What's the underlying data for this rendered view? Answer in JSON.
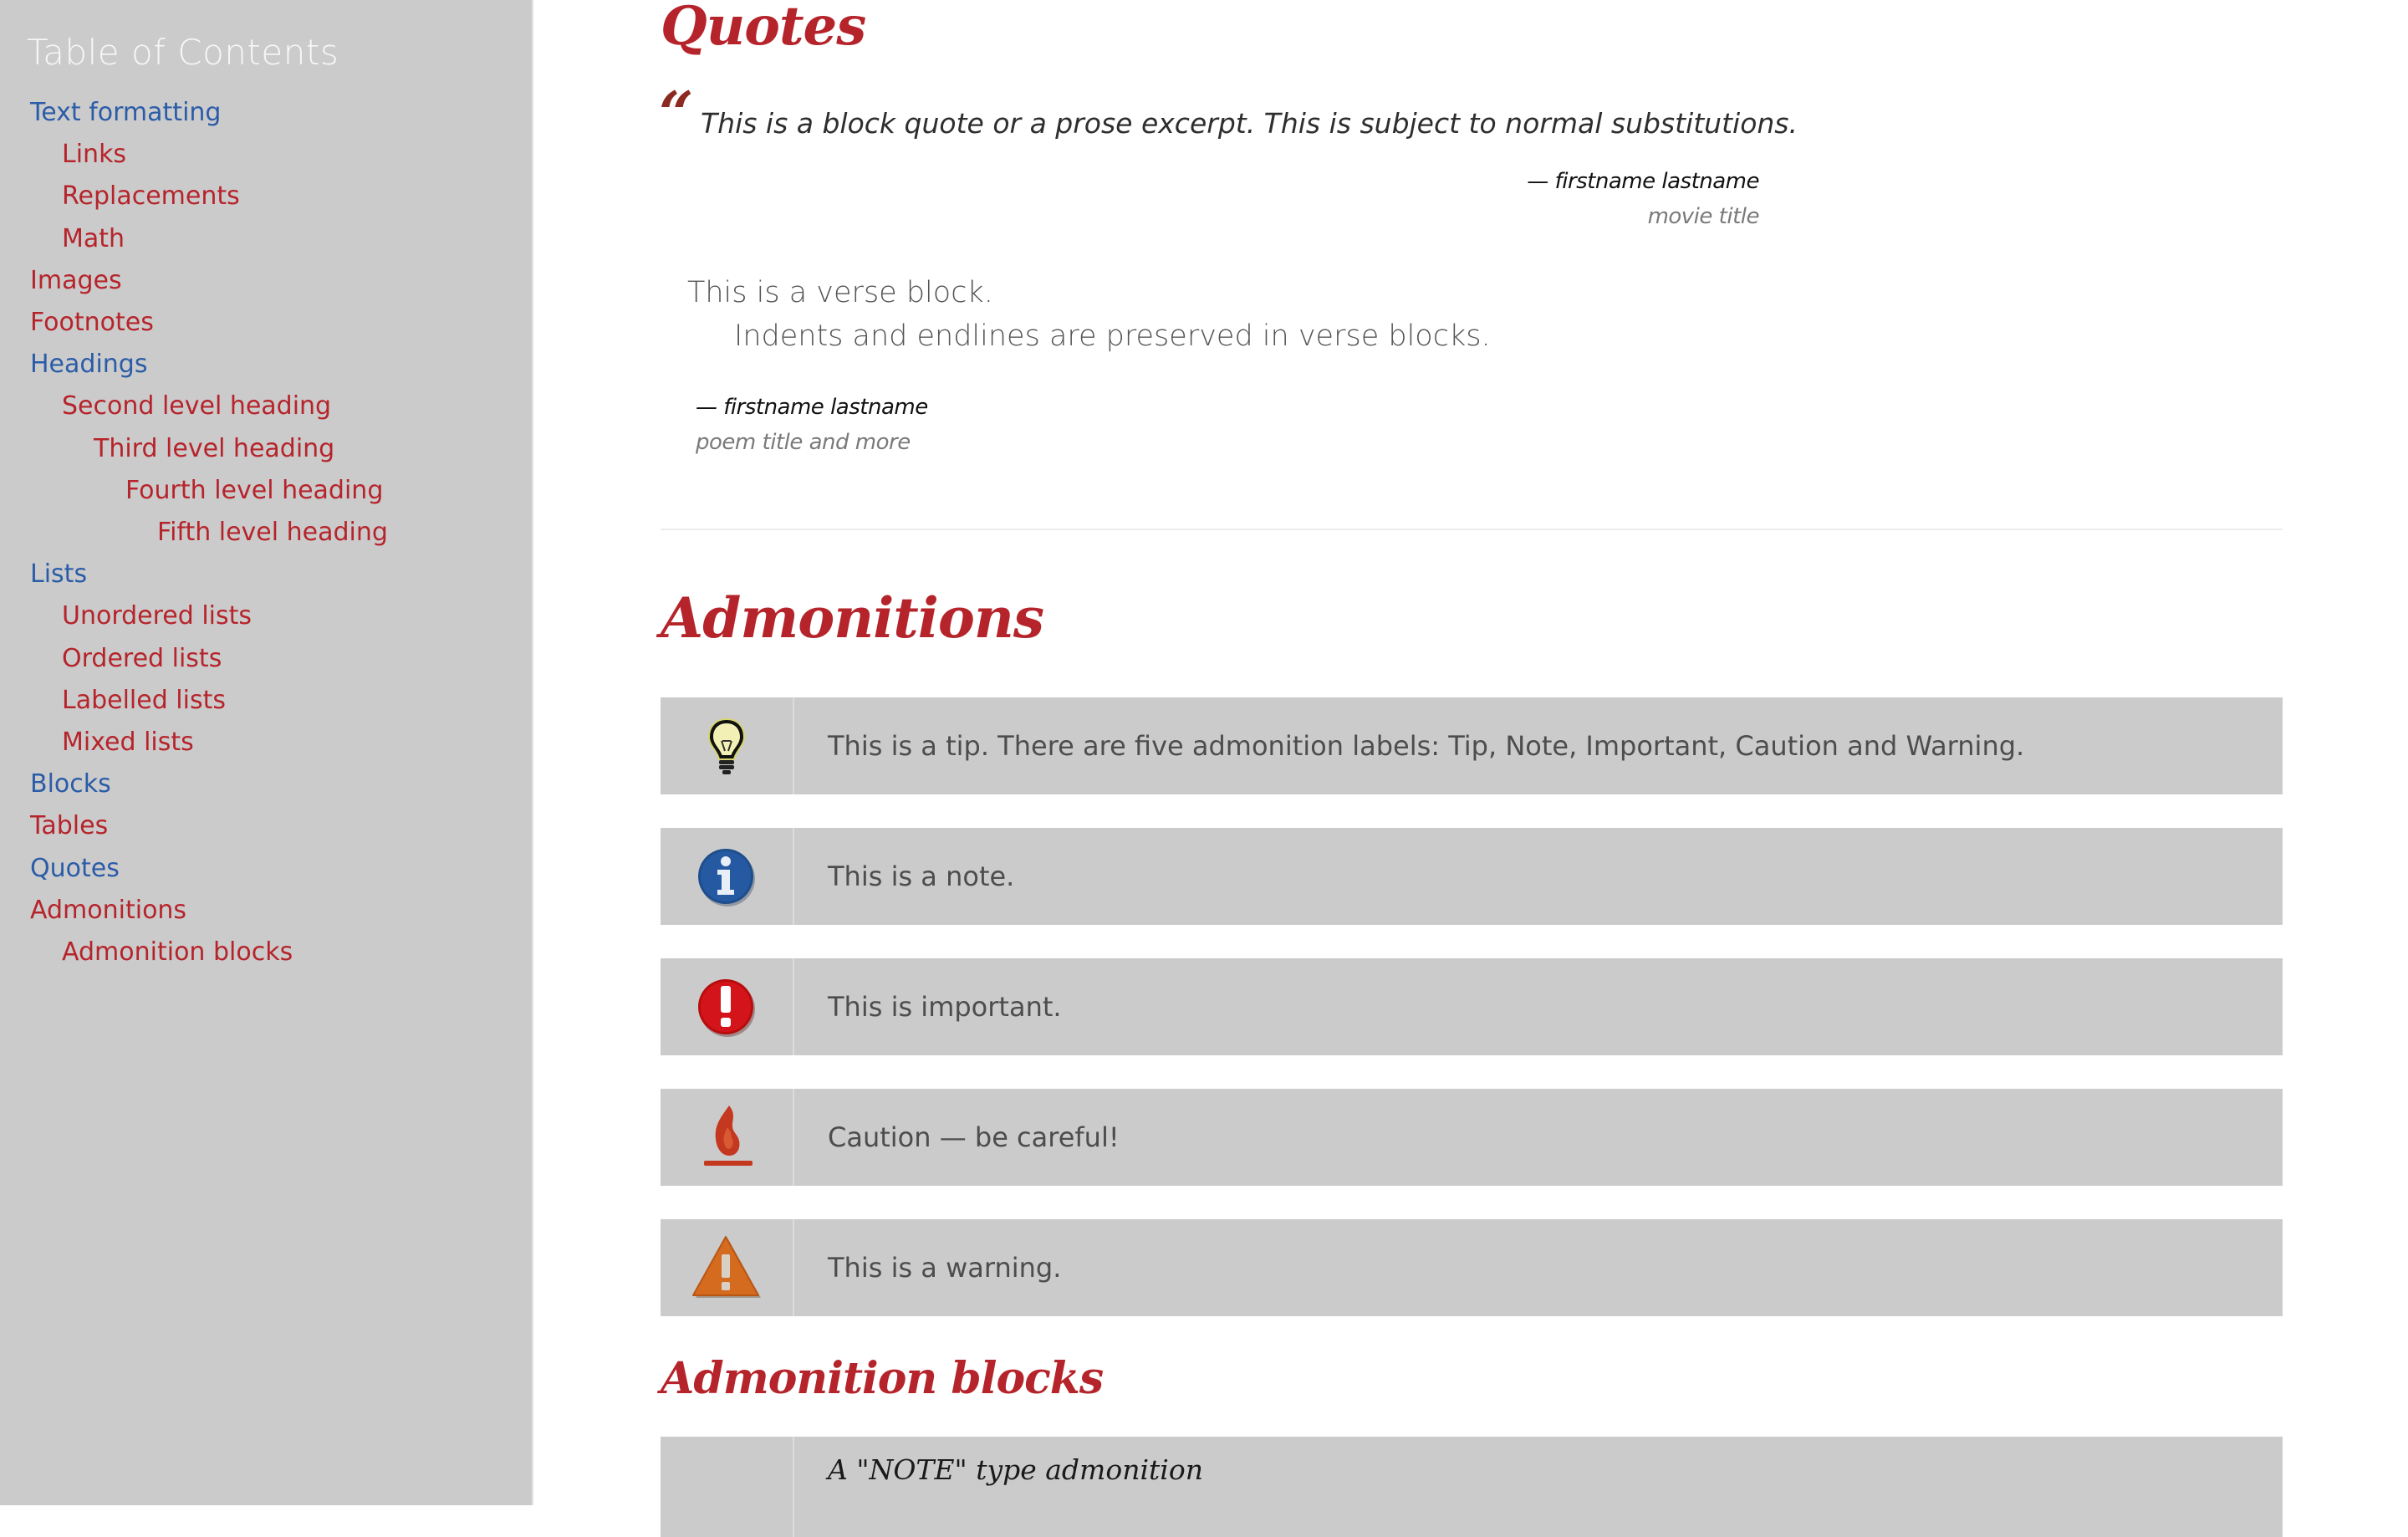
{
  "toc": {
    "title": "Table of Contents",
    "items": [
      {
        "label": "Text formatting",
        "level": 0,
        "color": "#2b5ca8"
      },
      {
        "label": "Links",
        "level": 1,
        "color": "#b6242b"
      },
      {
        "label": "Replacements",
        "level": 1,
        "color": "#b6242b"
      },
      {
        "label": "Math",
        "level": 1,
        "color": "#b6242b"
      },
      {
        "label": "Images",
        "level": 0,
        "color": "#b6242b"
      },
      {
        "label": "Footnotes",
        "level": 0,
        "color": "#b6242b"
      },
      {
        "label": "Headings",
        "level": 0,
        "color": "#2b5ca8"
      },
      {
        "label": "Second level heading",
        "level": 1,
        "color": "#b6242b"
      },
      {
        "label": "Third level heading",
        "level": 2,
        "color": "#b6242b"
      },
      {
        "label": "Fourth level heading",
        "level": 3,
        "color": "#b6242b"
      },
      {
        "label": "Fifth level heading",
        "level": 4,
        "color": "#b6242b"
      },
      {
        "label": "Lists",
        "level": 0,
        "color": "#2b5ca8"
      },
      {
        "label": "Unordered lists",
        "level": 1,
        "color": "#b6242b"
      },
      {
        "label": "Ordered lists",
        "level": 1,
        "color": "#b6242b"
      },
      {
        "label": "Labelled lists",
        "level": 1,
        "color": "#b6242b"
      },
      {
        "label": "Mixed lists",
        "level": 1,
        "color": "#b6242b"
      },
      {
        "label": "Blocks",
        "level": 0,
        "color": "#2b5ca8"
      },
      {
        "label": "Tables",
        "level": 0,
        "color": "#b6242b"
      },
      {
        "label": "Quotes",
        "level": 0,
        "color": "#2b5ca8"
      },
      {
        "label": "Admonitions",
        "level": 0,
        "color": "#b6242b"
      },
      {
        "label": "Admonition blocks",
        "level": 1,
        "color": "#b6242b"
      }
    ]
  },
  "quotes": {
    "heading": "Quotes",
    "quote_mark": "“",
    "block_quote": "This is a block quote or a prose excerpt. This is subject to normal substitutions.",
    "attribution": "— firstname lastname",
    "citation": "movie title"
  },
  "verse": {
    "line1": "This is a verse block.",
    "line2": "Indents and endlines are preserved in verse blocks.",
    "attribution": "— firstname lastname",
    "citation": "poem title and more"
  },
  "admonitions": {
    "heading": "Admonitions",
    "tip": {
      "icon": "lightbulb-icon",
      "text": "This is a tip. There are five admonition labels: Tip, Note, Important, Caution and Warning."
    },
    "note": {
      "icon": "info-icon",
      "text": "This is a note."
    },
    "important": {
      "icon": "exclamation-icon",
      "text": "This is important."
    },
    "caution": {
      "icon": "flame-icon",
      "text": "Caution — be careful!"
    },
    "warning": {
      "icon": "warning-triangle-icon",
      "text": "This is a warning."
    }
  },
  "admonition_blocks": {
    "heading": "Admonition blocks",
    "note_block_title": "A \"NOTE\" type admonition"
  },
  "colors": {
    "accent_red": "#b6242b",
    "link_blue": "#2b5ca8",
    "sidebar_bg": "#cbcbcb",
    "admonition_bg": "#cbcbcb"
  }
}
